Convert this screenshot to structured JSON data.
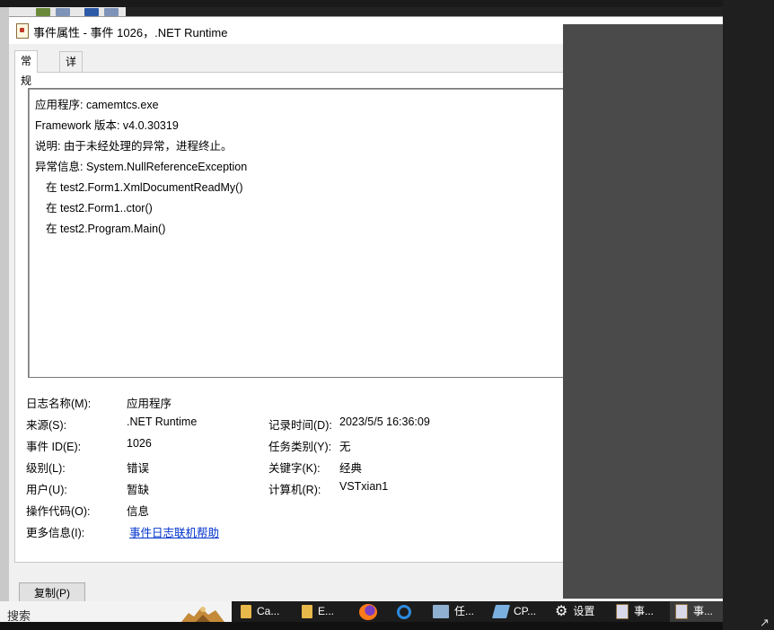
{
  "window": {
    "title": "事件属性 - 事件 1026，.NET Runtime"
  },
  "tabs": [
    {
      "label": "常规",
      "active": true
    },
    {
      "label": "详细信息",
      "active": false
    }
  ],
  "description": [
    "应用程序: camemtcs.exe",
    "Framework 版本: v4.0.30319",
    "说明: 由于未经处理的异常，进程终止。",
    "异常信息: System.NullReferenceException",
    "在 test2.Form1.XmlDocumentReadMy()",
    "在 test2.Form1..ctor()",
    "在 test2.Program.Main()"
  ],
  "fields": {
    "log_name": {
      "label": "日志名称(M):",
      "value": "应用程序"
    },
    "source": {
      "label": "来源(S):",
      "value": ".NET Runtime"
    },
    "event_id": {
      "label": "事件 ID(E):",
      "value": "1026"
    },
    "level": {
      "label": "级别(L):",
      "value": "错误"
    },
    "user": {
      "label": "用户(U):",
      "value": "暂缺"
    },
    "opcode": {
      "label": "操作代码(O):",
      "value": "信息"
    },
    "more_info": {
      "label": "更多信息(I):",
      "value": "事件日志联机帮助"
    },
    "logged": {
      "label": "记录时间(D):",
      "value": "2023/5/5 16:36:09"
    },
    "task_category": {
      "label": "任务类别(Y):",
      "value": "无"
    },
    "keywords": {
      "label": "关键字(K):",
      "value": "经典"
    },
    "computer": {
      "label": "计算机(R):",
      "value": "VSTxian1"
    }
  },
  "buttons": {
    "copy": "复制(P)"
  },
  "taskbar": {
    "search_placeholder": "搜索",
    "items": [
      {
        "label": "Ca...",
        "icon": "folder-icon"
      },
      {
        "label": "E...",
        "icon": "folder-icon"
      },
      {
        "label": "",
        "icon": "firefox-icon"
      },
      {
        "label": "",
        "icon": "search-app-icon"
      },
      {
        "label": "任...",
        "icon": "task-manager-icon"
      },
      {
        "label": "CP...",
        "icon": "cpu-app-icon"
      },
      {
        "label": "设置",
        "icon": "gear-icon"
      },
      {
        "label": "事...",
        "icon": "event-viewer-icon"
      },
      {
        "label": "事...",
        "icon": "event-viewer-icon",
        "active": true
      }
    ]
  },
  "colors": {
    "link": "#0033cc",
    "overlay": "#4a4a4a",
    "taskbar": "#1c1c1c"
  }
}
